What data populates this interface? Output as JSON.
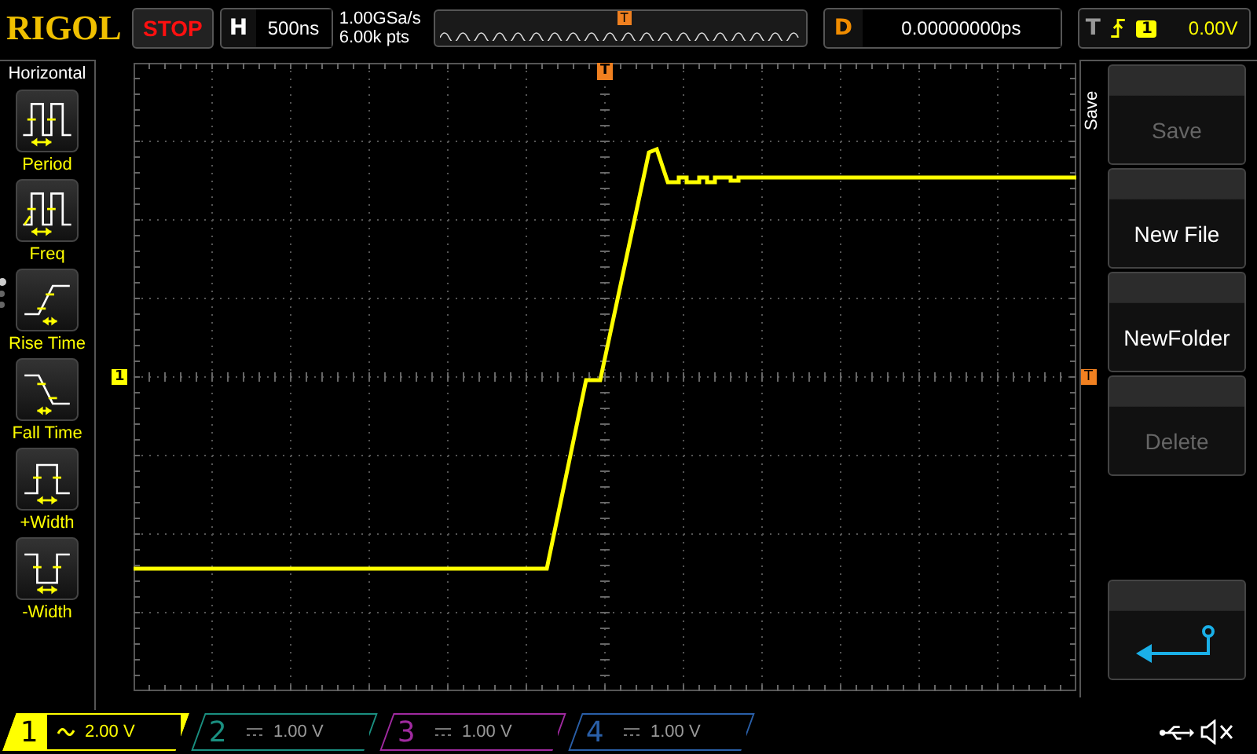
{
  "brand": "RIGOL",
  "run_state": {
    "label": "STOP"
  },
  "horizontal": {
    "label": "H",
    "timebase": "500ns"
  },
  "acquisition": {
    "sample_rate": "1.00GSa/s",
    "memory_depth": "6.00k pts"
  },
  "memory_marker": "T",
  "delay": {
    "label": "D",
    "value": "0.00000000ps"
  },
  "trigger": {
    "label": "T",
    "source": "1",
    "trigger_level": "0.00V"
  },
  "scope": {
    "top_trigger_marker": "T",
    "right_trigger_marker": "T",
    "channel_marker": "1"
  },
  "left_menu": {
    "title": "Horizontal",
    "pages": [
      {
        "selected": true
      },
      {
        "selected": false
      },
      {
        "selected": false
      }
    ],
    "items": [
      {
        "kind": "period",
        "label": "Period"
      },
      {
        "kind": "freq",
        "label": "Freq"
      },
      {
        "kind": "rise",
        "label": "Rise Time"
      },
      {
        "kind": "fall",
        "label": "Fall Time"
      },
      {
        "kind": "pwidth",
        "label": "+Width"
      },
      {
        "kind": "nwidth",
        "label": "-Width"
      }
    ]
  },
  "softkeys": {
    "title": "Save",
    "keys": [
      {
        "kind": "text",
        "label": "Save",
        "disabled": true
      },
      {
        "kind": "text",
        "label": "New File",
        "disabled": false
      },
      {
        "kind": "text",
        "label": "NewFolder",
        "disabled": false
      },
      {
        "kind": "text",
        "label": "Delete",
        "disabled": true
      },
      {
        "kind": "return"
      }
    ]
  },
  "channels": [
    {
      "number": "1",
      "kind": "ac",
      "scale": "2.00 V",
      "selected": true,
      "color": "#ffff00"
    },
    {
      "number": "2",
      "kind": "dc",
      "scale": "1.00 V",
      "selected": false,
      "color": "#1a8f80"
    },
    {
      "number": "3",
      "kind": "dc",
      "scale": "1.00 V",
      "selected": false,
      "color": "#a02aa0"
    },
    {
      "number": "4",
      "kind": "dc",
      "scale": "1.00 V",
      "selected": false,
      "color": "#2a5fa8"
    }
  ]
}
